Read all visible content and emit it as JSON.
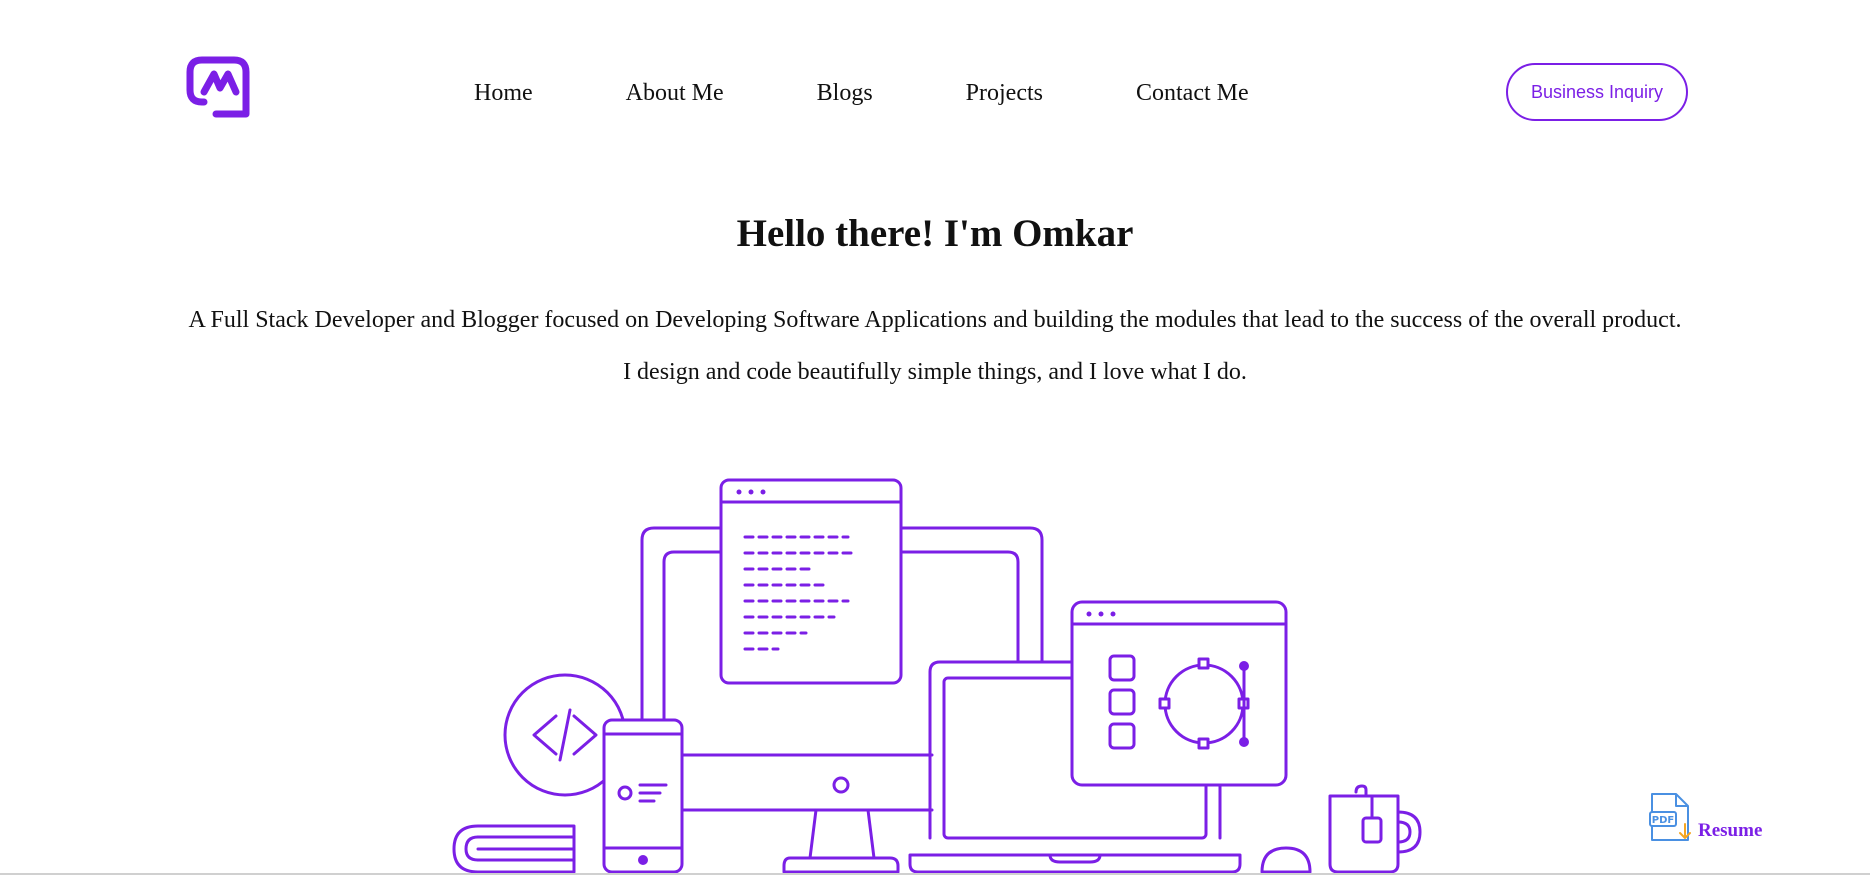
{
  "header": {
    "logo_icon": "m-monogram-logo-icon",
    "nav": [
      {
        "label": "Home"
      },
      {
        "label": "About Me"
      },
      {
        "label": "Blogs"
      },
      {
        "label": "Projects"
      },
      {
        "label": "Contact Me"
      }
    ],
    "cta_label": "Business Inquiry"
  },
  "hero": {
    "title": "Hello there! I'm Omkar",
    "line1": "A Full Stack Developer and Blogger focused on Developing Software Applications and building the modules that lead to the success of the overall product.",
    "line2": "I design and code beautifully simple things, and I love what I do.",
    "illustration_icon": "devices-workspace-illustration"
  },
  "resume": {
    "label": "Resume",
    "icon": "pdf-download-icon"
  },
  "colors": {
    "accent": "#7b1fe6",
    "text": "#111111",
    "background": "#ffffff"
  }
}
